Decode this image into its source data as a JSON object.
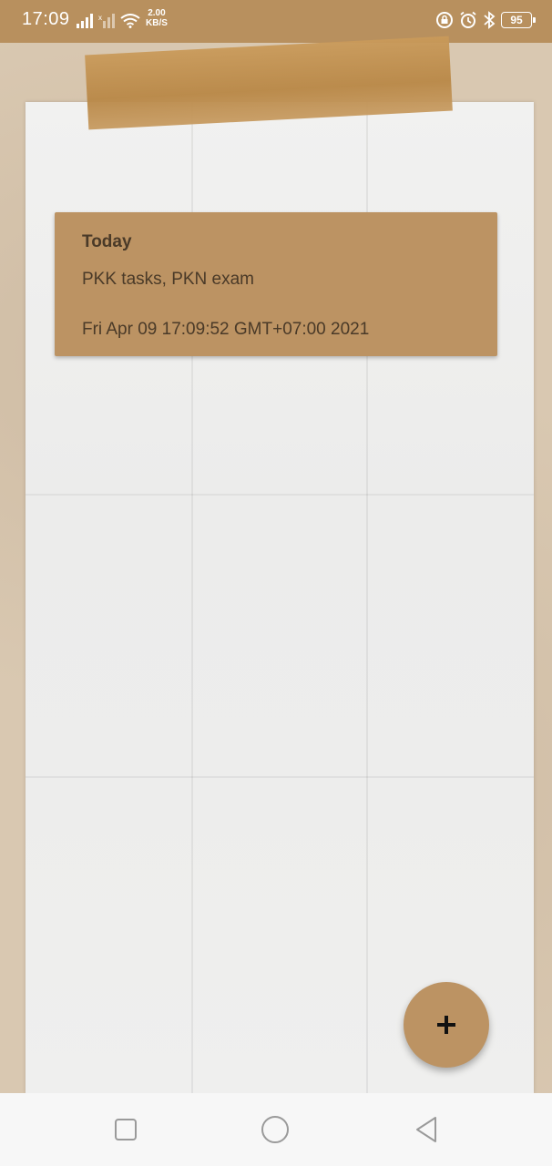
{
  "status_bar": {
    "time": "17:09",
    "net_speed_value": "2.00",
    "net_speed_unit": "KB/S",
    "battery": "95"
  },
  "note": {
    "title": "Today",
    "body": "PKK tasks, PKN exam",
    "date": "Fri Apr 09 17:09:52 GMT+07:00 2021"
  },
  "fab": {
    "icon": "plus-icon"
  },
  "nav_bar": {
    "icons": [
      "square-icon",
      "circle-icon",
      "triangle-back-icon"
    ]
  },
  "colors": {
    "accent": "#bc9363",
    "status_bar": "#b8905e",
    "text": "#4a3a28"
  }
}
